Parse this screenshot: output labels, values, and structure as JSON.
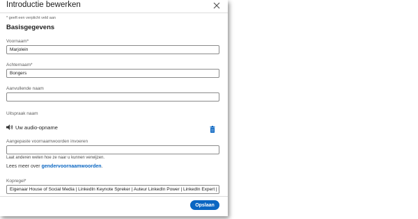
{
  "modal": {
    "title": "Introductie bewerken",
    "close_icon": "close-icon"
  },
  "form": {
    "required_note": "* geeft een verplicht veld aan",
    "section_title": "Basisgegevens",
    "first_name": {
      "label": "Voornaam*",
      "value": "Marjolein"
    },
    "last_name": {
      "label": "Achternaam*",
      "value": "Bongers"
    },
    "additional_name": {
      "label": "Aanvullende naam",
      "value": ""
    },
    "pronunciation": {
      "label": "Uitspraak naam",
      "audio_label": "Uw audio-opname",
      "speaker_icon": "speaker-icon",
      "delete_icon": "trash-icon"
    },
    "pronouns": {
      "label": "Aangepaste voornaamwoorden invoeren",
      "value": "",
      "hint": "Laat anderen weten hoe ze naar u kunnen verwijzen.",
      "learn_prefix": "Lees meer over ",
      "learn_link": "gendervoornaamwoorden",
      "learn_suffix": "."
    },
    "headline": {
      "label": "Kopregel*",
      "value": "Eigenaar House of Social Media | LinkedIn Keynote Spreker  | Auteur LinkedIn Power | LinkedIn Expert | Lin"
    }
  },
  "actions": {
    "save_label": "Opslaan"
  },
  "colors": {
    "accent": "#0a66c2",
    "text": "#1d1d1d",
    "muted": "#5e5e5e"
  }
}
